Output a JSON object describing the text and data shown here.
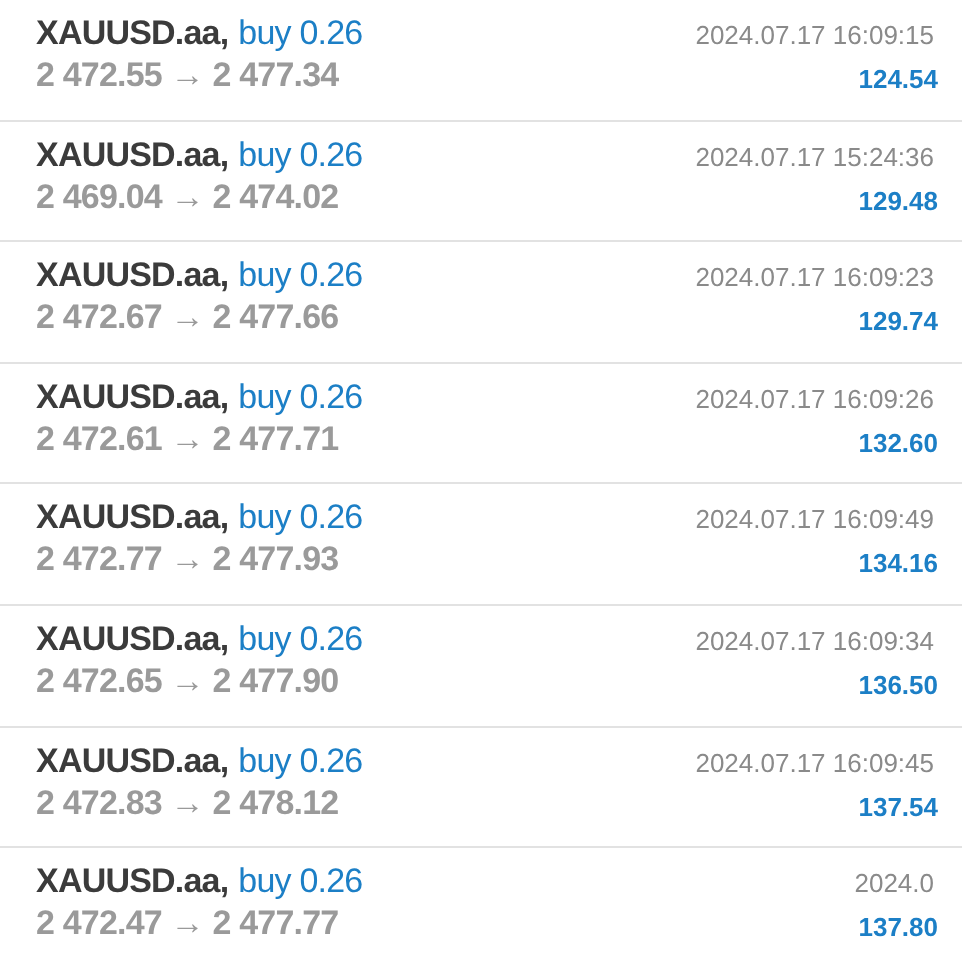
{
  "trades": [
    {
      "symbol": "XAUUSD.aa,",
      "order": "buy 0.26",
      "prices": "2 472.55 → 2 477.34",
      "time": "2024.07.17 16:09:15",
      "profit": "124.54"
    },
    {
      "symbol": "XAUUSD.aa,",
      "order": "buy 0.26",
      "prices": "2 469.04 → 2 474.02",
      "time": "2024.07.17 15:24:36",
      "profit": "129.48"
    },
    {
      "symbol": "XAUUSD.aa,",
      "order": "buy 0.26",
      "prices": "2 472.67 → 2 477.66",
      "time": "2024.07.17 16:09:23",
      "profit": "129.74"
    },
    {
      "symbol": "XAUUSD.aa,",
      "order": "buy 0.26",
      "prices": "2 472.61 → 2 477.71",
      "time": "2024.07.17 16:09:26",
      "profit": "132.60"
    },
    {
      "symbol": "XAUUSD.aa,",
      "order": "buy 0.26",
      "prices": "2 472.77 → 2 477.93",
      "time": "2024.07.17 16:09:49",
      "profit": "134.16"
    },
    {
      "symbol": "XAUUSD.aa,",
      "order": "buy 0.26",
      "prices": "2 472.65 → 2 477.90",
      "time": "2024.07.17 16:09:34",
      "profit": "136.50"
    },
    {
      "symbol": "XAUUSD.aa,",
      "order": "buy 0.26",
      "prices": "2 472.83 → 2 478.12",
      "time": "2024.07.17 16:09:45",
      "profit": "137.54"
    },
    {
      "symbol": "XAUUSD.aa,",
      "order": "buy 0.26",
      "prices": "2 472.47 → 2 477.77",
      "time": "2024.0",
      "profit": "137.80"
    }
  ]
}
